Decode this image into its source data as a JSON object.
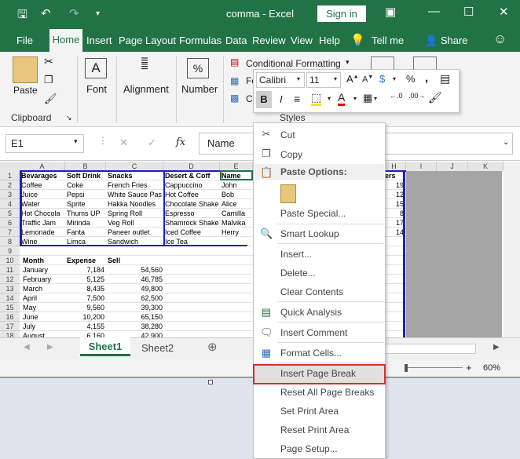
{
  "window": {
    "title": "comma  -  Excel",
    "signin": "Sign in"
  },
  "tabs": [
    "File",
    "Home",
    "Insert",
    "Page Layout",
    "Formulas",
    "Data",
    "Review",
    "View",
    "Help",
    "Tell me",
    "Share"
  ],
  "ribbon": {
    "paste": "Paste",
    "clipboard": "Clipboard",
    "font": "Font",
    "alignment": "Alignment",
    "number": "Number",
    "number_symbol": "%",
    "conditional": "Conditional Formatting",
    "fo": "Fo",
    "c": "C",
    "styles": "Styles"
  },
  "mini_toolbar": {
    "font": "Calibri",
    "size": "11",
    "bold": "B",
    "italic": "I",
    "dollar": "$",
    "percent": "%",
    "comma": ","
  },
  "formula_bar": {
    "namebox": "E1",
    "fx": "fx",
    "value": "Name"
  },
  "columns": [
    "A",
    "B",
    "C",
    "D",
    "E",
    "H",
    "I",
    "J",
    "K"
  ],
  "rows": [
    "1",
    "2",
    "3",
    "4",
    "5",
    "6",
    "7",
    "8",
    "9",
    "10",
    "11",
    "12",
    "13",
    "14",
    "15",
    "16",
    "17",
    "18"
  ],
  "table1": {
    "headers": [
      "Bevarages",
      "Soft Drink",
      "Snacks",
      "Desert & Coff",
      "Name"
    ],
    "rows": [
      [
        "Coffee",
        "Coke",
        "French Fries",
        "Cappuccino",
        "John"
      ],
      [
        "Juice",
        "Pepsi",
        "White Sauce Pas",
        "Hot Coffee",
        "Bob"
      ],
      [
        "Water",
        "Sprite",
        "Hakka Noodles",
        "Chocolate Shake",
        "Alice"
      ],
      [
        "Hot Chocola",
        "Thums UP",
        "Spring Roll",
        "Espresso",
        "Camilla"
      ],
      [
        "Traffic Jam",
        "Mirinda",
        "Veg Roll",
        "Shamrock Shake",
        "Malvika"
      ],
      [
        "Lemonade",
        "Fanta",
        "Paneer outlet",
        "Iced Coffee",
        "Herry"
      ],
      [
        "Wine",
        "Limca",
        "Sandwich",
        "Ice Tea",
        ""
      ]
    ],
    "h_header": "ers",
    "h_values": [
      "19",
      "12",
      "15",
      "8",
      "17",
      "14"
    ]
  },
  "table2": {
    "headers": [
      "Month",
      "Expense",
      "Sell"
    ],
    "rows": [
      [
        "January",
        "7,184",
        "54,560"
      ],
      [
        "February",
        "5,125",
        "46,785"
      ],
      [
        "March",
        "8,435",
        "49,800"
      ],
      [
        "April",
        "7,500",
        "62,500"
      ],
      [
        "May",
        "9,560",
        "39,300"
      ],
      [
        "June",
        "10,200",
        "65,150"
      ],
      [
        "July",
        "4,155",
        "38,280"
      ],
      [
        "August",
        "6,160",
        "42,900"
      ]
    ]
  },
  "sheets": {
    "sheet1": "Sheet1",
    "sheet2": "Sheet2"
  },
  "status": {
    "zoom": "60%"
  },
  "context_menu": {
    "cut": "Cut",
    "copy": "Copy",
    "paste_options": "Paste Options:",
    "paste_special": "Paste Special...",
    "smart_lookup": "Smart Lookup",
    "insert": "Insert...",
    "delete": "Delete...",
    "clear": "Clear Contents",
    "quick_analysis": "Quick Analysis",
    "insert_comment": "Insert Comment",
    "format_cells": "Format Cells...",
    "insert_page_break": "Insert Page Break",
    "reset_page_breaks": "Reset All Page Breaks",
    "set_print_area": "Set Print Area",
    "reset_print_area": "Reset Print Area",
    "page_setup": "Page Setup..."
  },
  "colors": {
    "excel_green": "#217346",
    "highlight_red": "#d32f2f",
    "page_border": "#1f1fbf"
  }
}
